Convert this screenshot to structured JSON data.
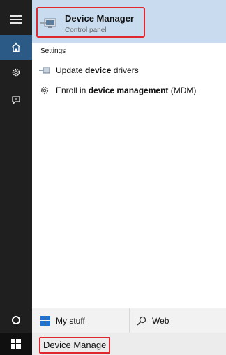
{
  "best_match": {
    "title": "Device Manager",
    "subtitle": "Control panel"
  },
  "settings": {
    "label": "Settings",
    "items": [
      {
        "pre": "Update ",
        "bold": "device",
        "post": " drivers",
        "icon": "device-driver-icon"
      },
      {
        "pre": "Enroll in ",
        "bold": "device management",
        "post": " (MDM)",
        "icon": "gear-icon"
      }
    ]
  },
  "tabs": {
    "my_stuff": "My stuff",
    "web": "Web"
  },
  "search": {
    "value": "Device Manage"
  },
  "rail": {
    "icons": [
      "hamburger-icon",
      "home-icon",
      "settings-icon",
      "feedback-icon",
      "cortana-circle-icon"
    ]
  },
  "colors": {
    "accent": "#2a5a85",
    "highlight": "#c9dcef",
    "annotation": "#e0262e"
  }
}
